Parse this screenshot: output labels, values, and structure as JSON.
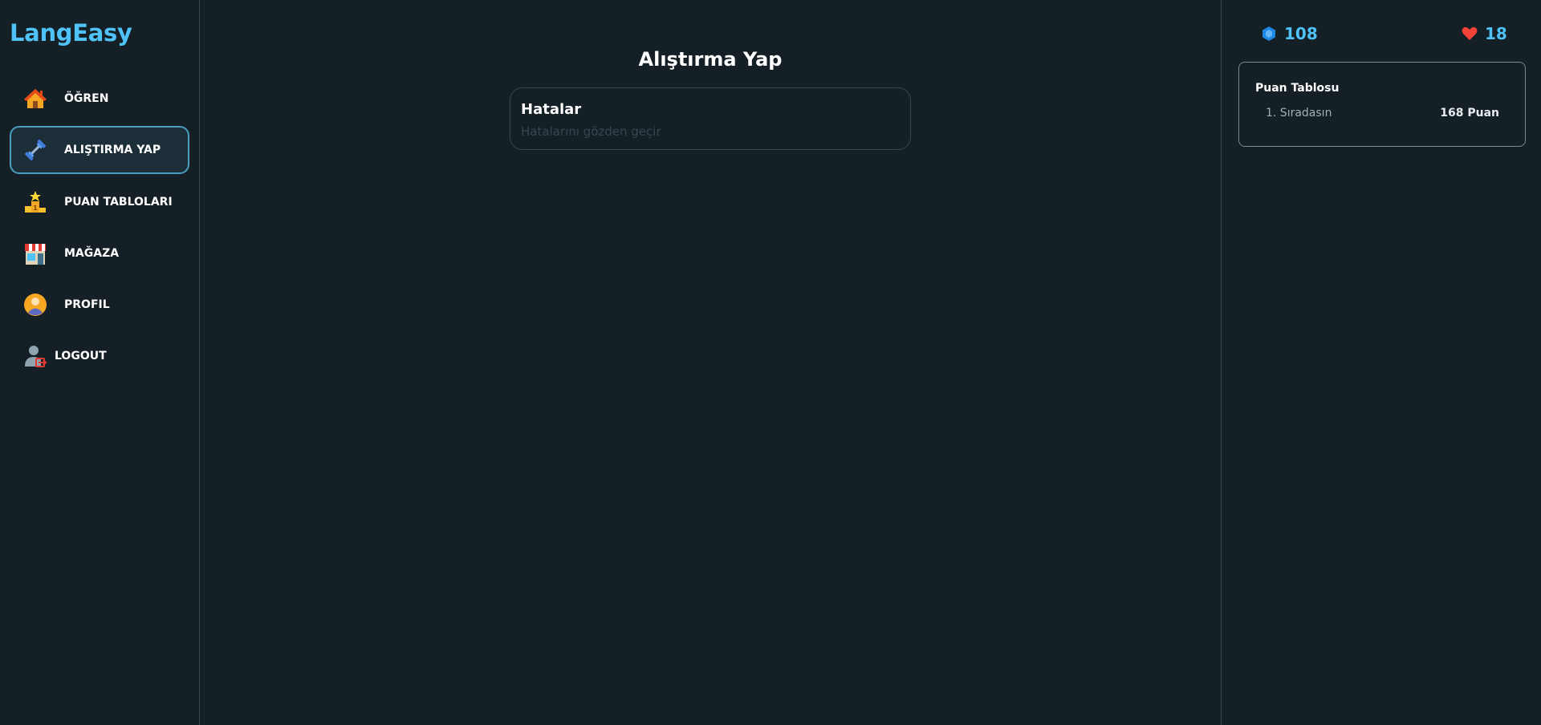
{
  "app": {
    "name": "LangEasy",
    "brand_color": "#4fc3f7",
    "background": "#141f26"
  },
  "sidebar": {
    "items": [
      {
        "label": "ÖĞREN",
        "icon": "home-icon",
        "active": false
      },
      {
        "label": "ALIŞTIRMA YAP",
        "icon": "dumbbell-icon",
        "active": true
      },
      {
        "label": "PUAN TABLOLARI",
        "icon": "podium-icon",
        "active": false
      },
      {
        "label": "MAĞAZA",
        "icon": "shop-icon",
        "active": false
      },
      {
        "label": "PROFIL",
        "icon": "profile-icon",
        "active": false
      },
      {
        "label": "LOGOUT",
        "icon": "logout-icon",
        "active": false
      }
    ]
  },
  "main": {
    "title": "Alıştırma Yap",
    "cards": [
      {
        "title": "Hatalar",
        "subtitle": "Hatalarını gözden geçir"
      }
    ]
  },
  "stats": {
    "gems": {
      "value": "108",
      "icon": "gem-icon"
    },
    "hearts": {
      "value": "18",
      "icon": "heart-icon"
    }
  },
  "leaderboard": {
    "title": "Puan Tablosu",
    "rank_text": "1. Sıradasın",
    "points_text": "168 Puan"
  }
}
